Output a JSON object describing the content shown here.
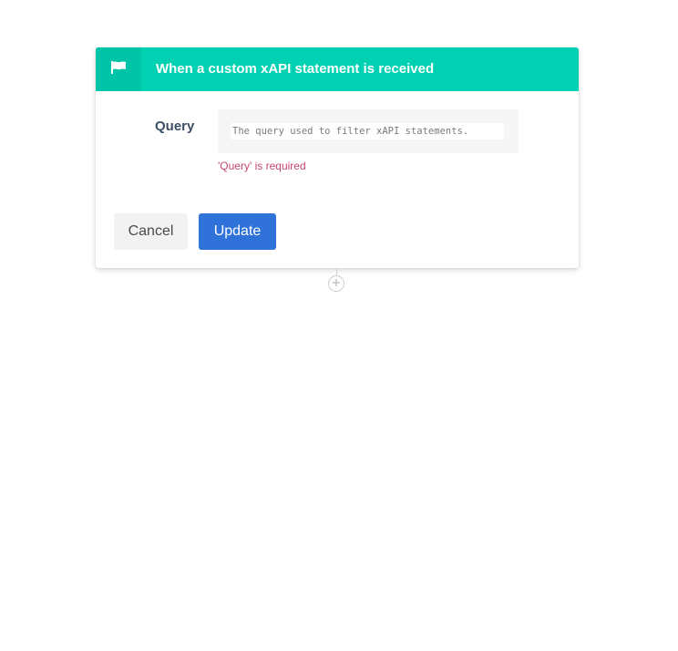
{
  "trigger": {
    "header_title": "When a custom xAPI statement is received",
    "header_icon": "flag-icon",
    "header_color": "#00d1b2"
  },
  "form": {
    "query_label": "Query",
    "query_value": "",
    "query_placeholder": "The query used to filter xAPI statements.",
    "query_error": "'Query' is required"
  },
  "actions": {
    "cancel_label": "Cancel",
    "update_label": "Update",
    "update_color": "#2f72d9"
  },
  "flow": {
    "add_step_icon": "plus-circle-icon"
  }
}
